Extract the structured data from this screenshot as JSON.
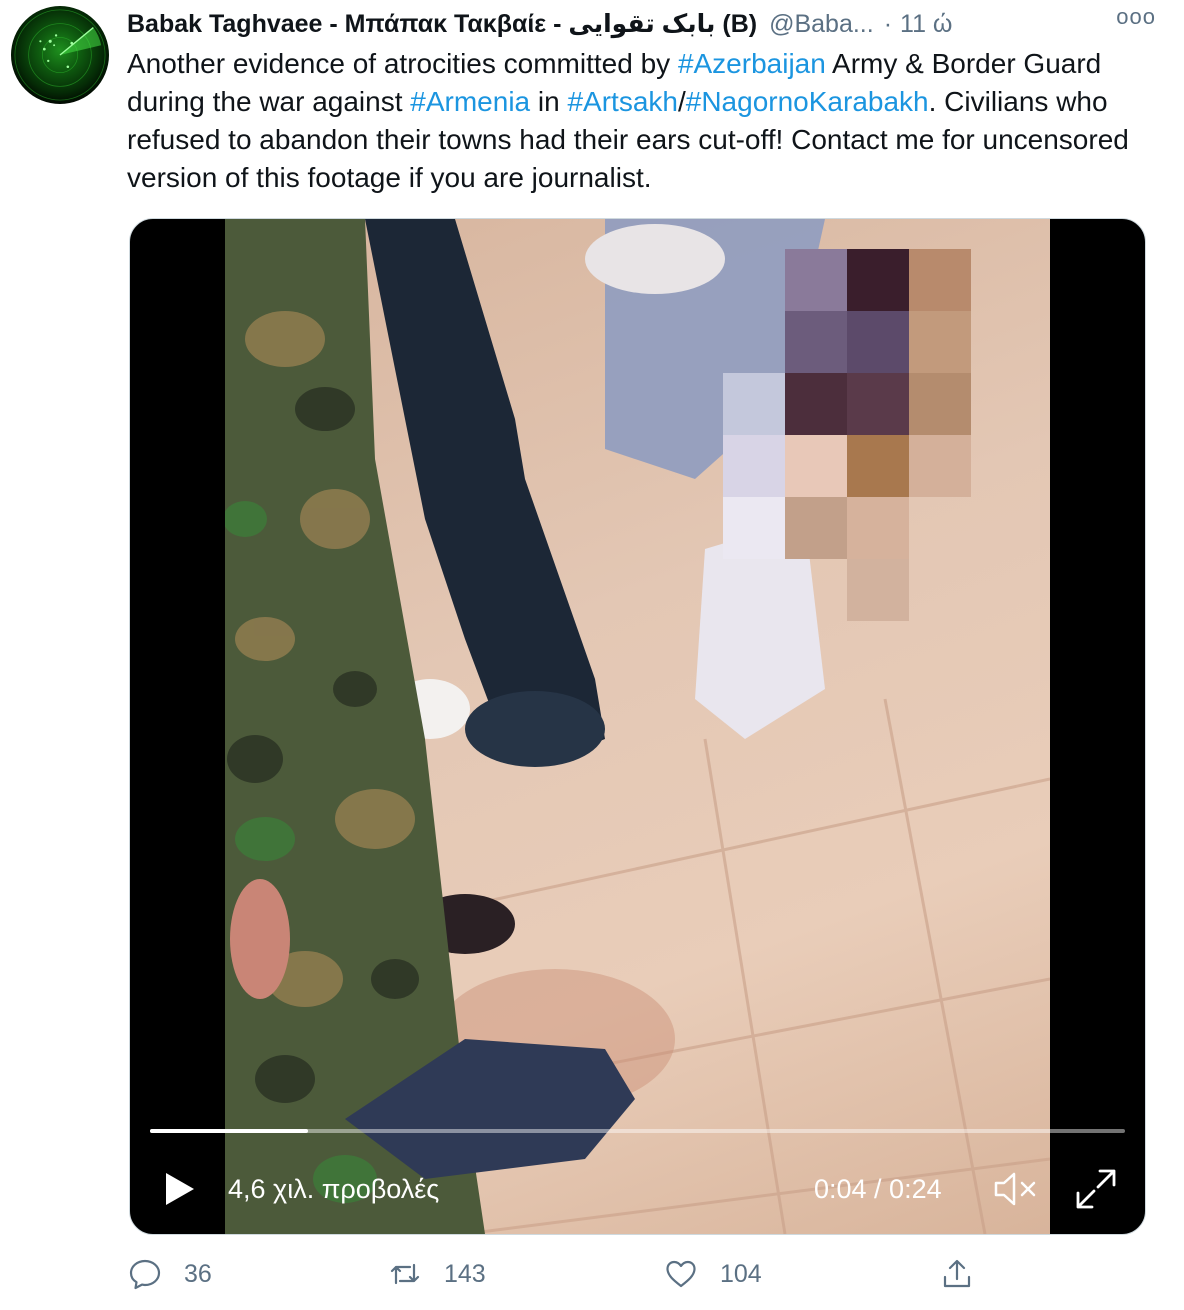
{
  "tweet": {
    "display_name": "Babak Taghvaee - Μπάπακ Τακβαίε - بابک تقوایی (B)",
    "handle": "@Baba...",
    "separator": "·",
    "time": "11 ώ",
    "more_glyph": "ooo",
    "text": {
      "t1": "Another evidence of atrocities committed by ",
      "h1": "#Azerbaijan",
      "t2": " Army & Border Guard during the war against ",
      "h2": "#Armenia",
      "t3": " in ",
      "h3": "#Artsakh",
      "t4": "/",
      "h4": "#NagornoKarabakh",
      "t5": ". Civilians who refused to abandon their towns had their ears cut-off! Contact me for uncensored version of this footage if you are journalist."
    }
  },
  "video": {
    "views": "4,6 χιλ. προβολές",
    "timecode": "0:04 / 0:24",
    "progress_fraction": 0.162
  },
  "actions": {
    "replies": "36",
    "retweets": "143",
    "likes": "104"
  },
  "colors": {
    "link": "#1b95e0",
    "muted": "#5b7083",
    "text": "#0f1419",
    "border": "#cfd9de"
  },
  "icons": [
    "avatar-radar",
    "more-icon",
    "play-icon",
    "mute-icon",
    "fullscreen-icon",
    "reply-icon",
    "retweet-icon",
    "like-icon",
    "share-icon"
  ]
}
